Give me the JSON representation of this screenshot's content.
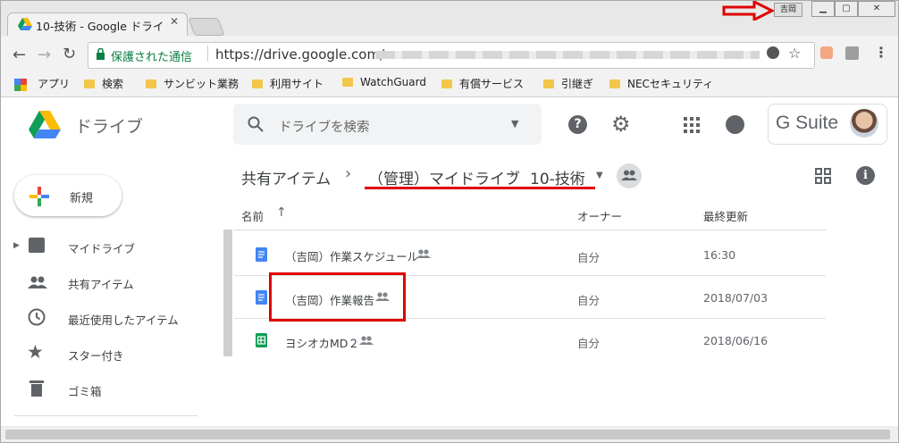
{
  "browser": {
    "tab_title": "10-技術 - Google ドライ",
    "user_badge": "吉岡",
    "secure_label": "保護された通信",
    "url": "https://drive.google.com/"
  },
  "bookmarks": [
    {
      "label": "アプリ"
    },
    {
      "label": "検索"
    },
    {
      "label": "サンビット業務"
    },
    {
      "label": "利用サイト"
    },
    {
      "label": "WatchGuard"
    },
    {
      "label": "有償サービス"
    },
    {
      "label": "引継ぎ"
    },
    {
      "label": "NECセキュリティ"
    }
  ],
  "drive": {
    "app_name": "ドライブ",
    "search_placeholder": "ドライブを検索",
    "gsuite": "G Suite"
  },
  "breadcrumb": {
    "root": "共有アイテム",
    "middle": "（管理）マイドライブ",
    "current": "10-技術"
  },
  "columns": {
    "name": "名前",
    "owner": "オーナー",
    "modified": "最終更新"
  },
  "sidebar": {
    "new_label": "新規",
    "items": [
      {
        "label": "マイドライブ"
      },
      {
        "label": "共有アイテム"
      },
      {
        "label": "最近使用したアイテム"
      },
      {
        "label": "スター付き"
      },
      {
        "label": "ゴミ箱"
      }
    ]
  },
  "files": [
    {
      "name": "（吉岡）作業スケジュール",
      "owner": "自分",
      "modified": "16:30",
      "type": "doc"
    },
    {
      "name": "（吉岡）作業報告",
      "owner": "自分",
      "modified": "2018/07/03",
      "type": "doc"
    },
    {
      "name": "ヨシオカMD２",
      "owner": "自分",
      "modified": "2018/06/16",
      "type": "sheet"
    }
  ],
  "colors": {
    "accent_red": "#e00000",
    "doc_blue": "#4285f4",
    "sheet_green": "#0f9d58"
  }
}
